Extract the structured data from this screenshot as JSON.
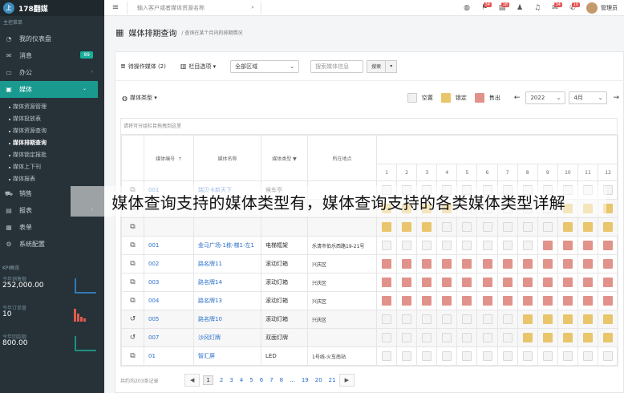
{
  "app": {
    "title": "178翻媒",
    "logo_mark": "上"
  },
  "sidebar": {
    "section_label": "主控菜单",
    "items": [
      {
        "label": "我的仪表盘",
        "icon": "dashboard-icon"
      },
      {
        "label": "消息",
        "icon": "envelope-icon",
        "badge": "89"
      },
      {
        "label": "办公",
        "icon": "monitor-icon"
      },
      {
        "label": "媒体",
        "icon": "image-icon",
        "active": true
      },
      {
        "label": "销售",
        "icon": "cart-icon"
      },
      {
        "label": "报表",
        "icon": "chart-icon"
      },
      {
        "label": "表单",
        "icon": "table-icon"
      },
      {
        "label": "系统配置",
        "icon": "gear-icon"
      }
    ],
    "sub_items": [
      "媒体资源管理",
      "媒体投放表",
      "媒体资源查询",
      "媒体排期查询",
      "媒体锁定报批",
      "媒体上下刊",
      "媒体报表"
    ],
    "current_sub": "媒体排期查询",
    "kpi_title": "KPI概览",
    "kpis": [
      {
        "label": "今年销售额",
        "value": "252,000.00",
        "color": "#3b8fe0"
      },
      {
        "label": "今年订单量",
        "value": "10",
        "color": "#e05a4f"
      },
      {
        "label": "今年回款额",
        "value": "800.00",
        "color": "#1aae9a"
      }
    ]
  },
  "topbar": {
    "search_placeholder": "输入客户或者媒体资源名称",
    "badges": {
      "mail": "34",
      "tasks": "18",
      "msg1": "34",
      "msg2": "10"
    },
    "user_name": "管理员"
  },
  "page": {
    "title": "媒体排期查询",
    "subtitle": "查询在某个月内的排期情况"
  },
  "toolbar": {
    "pending_label": "待操作媒体",
    "pending_count": "(2)",
    "columns_label": "栏目选项",
    "region_select": "全部区域",
    "media_input_placeholder": "搜索媒体信息",
    "search_btn": "搜索",
    "media_type_label": "媒体类型",
    "legend": [
      {
        "label": "空置",
        "color": "#f1f1f1"
      },
      {
        "label": "锁定",
        "color": "#e9c56b"
      },
      {
        "label": "售出",
        "color": "#e1938b"
      }
    ],
    "year": "2022",
    "month": "4月"
  },
  "table": {
    "note": "请将可分组栏目拖拽到这里",
    "headers": {
      "code": "媒体编号",
      "name": "媒体名称",
      "type": "媒体类型",
      "addr": "所在地点"
    },
    "months": [
      "1",
      "2",
      "3",
      "4",
      "5",
      "6",
      "7",
      "8",
      "9",
      "10",
      "11",
      "12"
    ],
    "rows": [
      {
        "icon": "copy-icon",
        "code": "001",
        "name": "瑞贝卡新天下",
        "type": "候车亭",
        "addr": "",
        "cells": "eeeeeeeeeeee",
        "grey": false
      },
      {
        "icon": "copy-icon",
        "code": "",
        "name": "",
        "type": "",
        "addr": "",
        "cells": "lllleeeeelll",
        "grey": true
      },
      {
        "icon": "copy-icon",
        "code": "",
        "name": "",
        "type": "",
        "addr": "",
        "cells": "llleeeeeelll",
        "grey": true
      },
      {
        "icon": "copy-icon",
        "code": "001",
        "name": "金马广场-1栋-梯1-左1",
        "type": "电梯框架",
        "addr": "乐清市伯乐西路19-21号",
        "cells": "eeeeeeeessss",
        "grey": false
      },
      {
        "icon": "copy-icon",
        "code": "002",
        "name": "路名牌11",
        "type": "滚动灯箱",
        "addr": "兴庆区",
        "cells": "ssssssssssss",
        "grey": false
      },
      {
        "icon": "copy-icon",
        "code": "003",
        "name": "路名牌14",
        "type": "滚动灯箱",
        "addr": "兴庆区",
        "cells": "ssssssssssss",
        "grey": false
      },
      {
        "icon": "copy-icon",
        "code": "004",
        "name": "路名牌13",
        "type": "滚动灯箱",
        "addr": "兴庆区",
        "cells": "ssssssssssss",
        "grey": false
      },
      {
        "icon": "undo-icon",
        "code": "005",
        "name": "路名牌10",
        "type": "滚动灯箱",
        "addr": "兴庆区",
        "cells": "eeeeeeelllll",
        "grey": true
      },
      {
        "icon": "undo-icon",
        "code": "007",
        "name": "沙冈灯牌",
        "type": "双面灯牌",
        "addr": "",
        "cells": "eeeeeeelllll",
        "grey": true
      },
      {
        "icon": "copy-icon",
        "code": "01",
        "name": "智汇屏",
        "type": "LED",
        "addr": "1号线-火车南站",
        "cells": "eeeeeeeeeeee",
        "grey": false
      }
    ]
  },
  "pager": {
    "info": "共约均203条记录",
    "pages": [
      "1",
      "2",
      "3",
      "4",
      "5",
      "6",
      "7",
      "8",
      "...",
      "19",
      "20",
      "21"
    ]
  },
  "overlay_caption": "媒体查询支持的媒体类型有，媒体查询支持的各类媒体类型详解"
}
